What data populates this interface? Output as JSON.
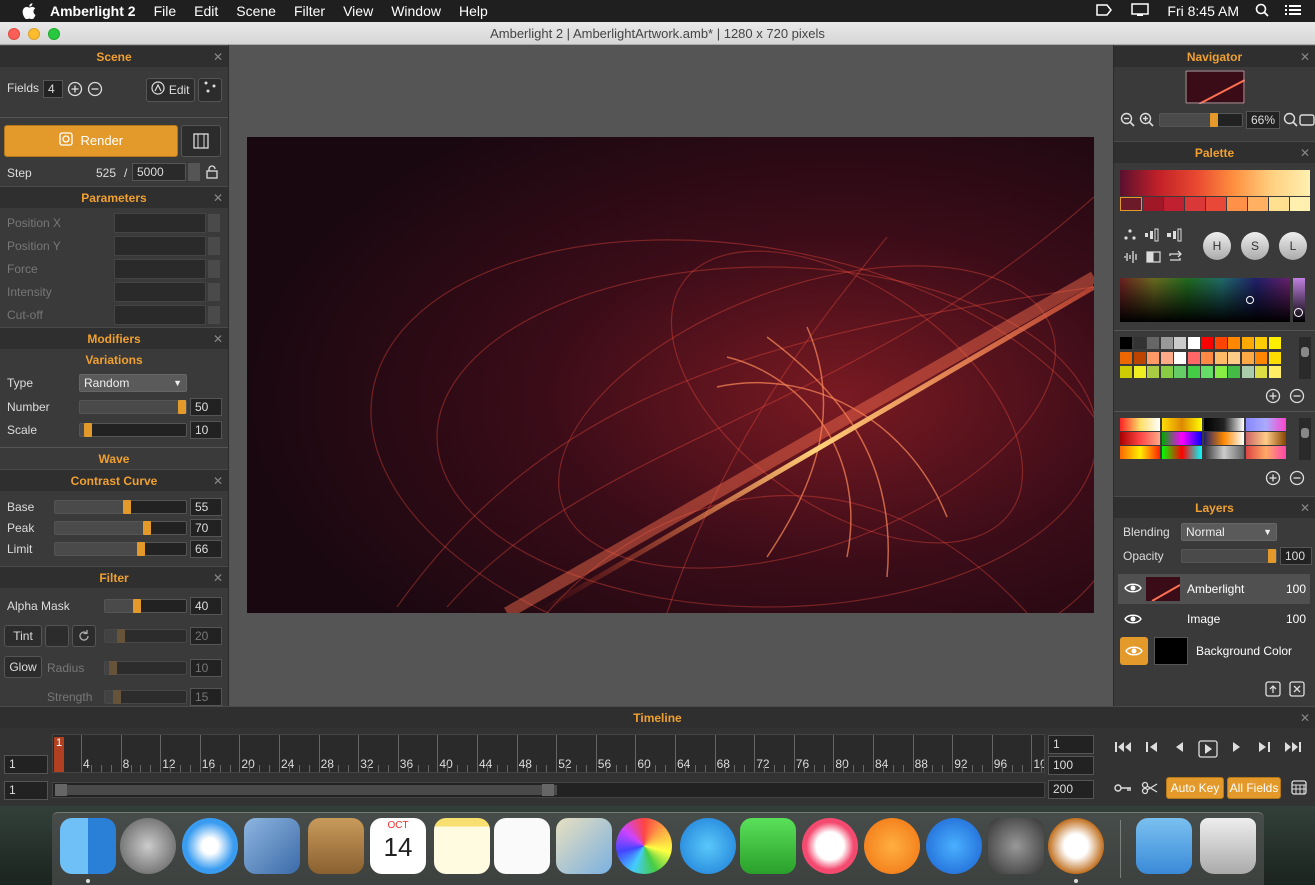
{
  "menubar": {
    "app_name": "Amberlight 2",
    "items": [
      "File",
      "Edit",
      "Scene",
      "Filter",
      "View",
      "Window",
      "Help"
    ],
    "clock": "Fri 8:45 AM"
  },
  "window": {
    "title": "Amberlight 2 | AmberlightArtwork.amb* | 1280 x 720 pixels"
  },
  "scene": {
    "header": "Scene",
    "fields_label": "Fields",
    "fields_value": "4",
    "edit_label": "Edit",
    "render_label": "Render",
    "step_label": "Step",
    "step_value": "525",
    "step_sep": "/",
    "step_total": "5000"
  },
  "parameters": {
    "header": "Parameters",
    "items": [
      "Position X",
      "Position Y",
      "Force",
      "Intensity",
      "Cut-off"
    ]
  },
  "modifiers": {
    "header": "Modifiers",
    "variations_title": "Variations",
    "type_label": "Type",
    "type_value": "Random",
    "number_label": "Number",
    "number_value": "50",
    "number_level": 0.98,
    "scale_label": "Scale",
    "scale_value": "10",
    "scale_level": 0.08,
    "wave_title": "Wave"
  },
  "contrast": {
    "header": "Contrast Curve",
    "base_label": "Base",
    "base_value": "55",
    "base_level": 0.55,
    "peak_label": "Peak",
    "peak_value": "70",
    "peak_level": 0.7,
    "limit_label": "Limit",
    "limit_value": "66",
    "limit_level": 0.66
  },
  "filter": {
    "header": "Filter",
    "alpha_label": "Alpha Mask",
    "alpha_value": "40",
    "alpha_level": 0.4,
    "tint_label": "Tint",
    "tint_value": "20",
    "tint_level": 0.2,
    "glow_label": "Glow",
    "radius_label": "Radius",
    "radius_value": "10",
    "radius_level": 0.1,
    "strength_label": "Strength",
    "strength_value": "15",
    "strength_level": 0.15
  },
  "navigator": {
    "header": "Navigator",
    "zoom": "66%",
    "zoom_level": 0.66
  },
  "palette": {
    "header": "Palette",
    "h_label": "H",
    "s_label": "S",
    "l_label": "L"
  },
  "layers": {
    "header": "Layers",
    "blending_label": "Blending",
    "blending_value": "Normal",
    "opacity_label": "Opacity",
    "opacity_value": "100",
    "opacity_level": 1.0,
    "items": [
      {
        "name": "Amberlight",
        "value": "100"
      },
      {
        "name": "Image",
        "value": "100"
      },
      {
        "name": "Background Color",
        "value": ""
      }
    ]
  },
  "timeline": {
    "header": "Timeline",
    "left_top": "1",
    "left_bottom": "1",
    "right_1": "1",
    "right_2": "100",
    "right_3": "200",
    "marker": "1",
    "ticks": [
      "4",
      "8",
      "12",
      "16",
      "20",
      "24",
      "28",
      "32",
      "36",
      "40",
      "44",
      "48",
      "52",
      "56",
      "60",
      "64",
      "68",
      "72",
      "76",
      "80",
      "84",
      "88",
      "92",
      "96",
      "10"
    ],
    "auto_key": "Auto Key",
    "all_fields": "All Fields"
  },
  "dock": {
    "calendar_month": "OCT",
    "calendar_day": "14"
  }
}
